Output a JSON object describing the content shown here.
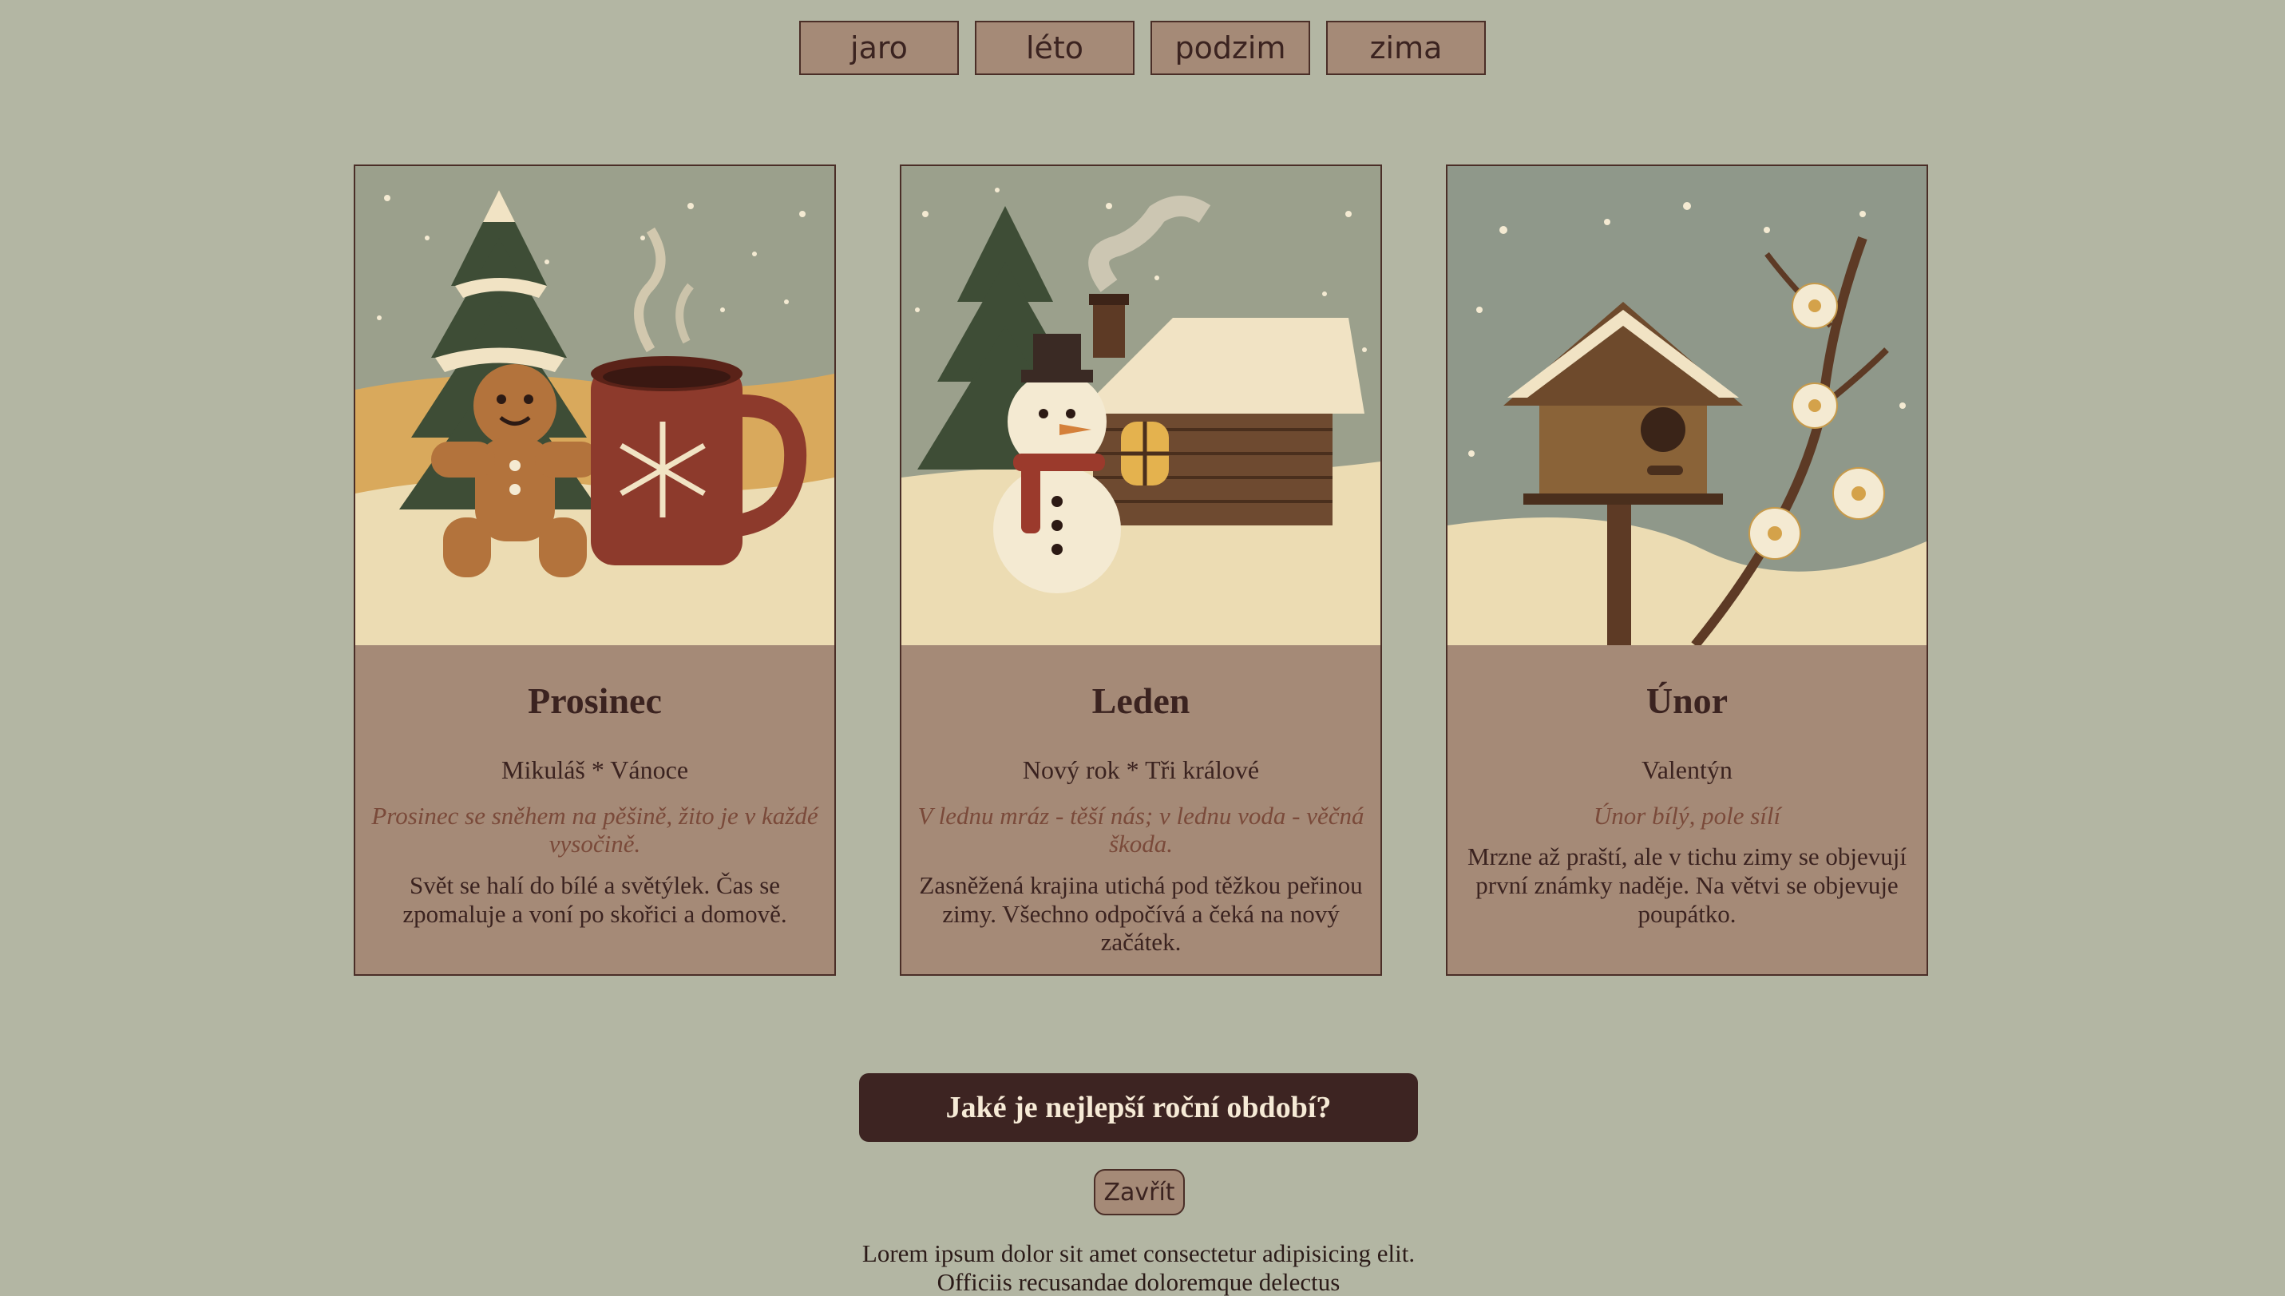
{
  "nav": {
    "items": [
      "jaro",
      "léto",
      "podzim",
      "zima"
    ]
  },
  "cards": [
    {
      "title": "Prosinec",
      "events": "Mikuláš * Vánoce",
      "proverb": "Prosinec se sněhem na pěšině, žito je v každé vysočině.",
      "text": "Svět se halí do bílé a světýlek. Čas se zpomaluje a voní po skořici a domově."
    },
    {
      "title": "Leden",
      "events": "Nový rok * Tři králové",
      "proverb": "V lednu mráz - těší nás; v lednu voda - věčná škoda.",
      "text": "Zasněžená krajina utichá pod těžkou peřinou zimy. Všechno odpočívá a čeká na nový začátek."
    },
    {
      "title": "Únor",
      "events": "Valentýn",
      "proverb": "Únor bílý, pole sílí",
      "text": "Mrzne až praští, ale v tichu zimy se objevují první známky naděje. Na větvi se objevuje poupátko."
    }
  ],
  "question": "Jaké je nejlepší roční období?",
  "close_label": "Zavřít",
  "lorem": "Lorem ipsum dolor sit amet consectetur adipisicing elit. Officiis recusandae doloremque delectus",
  "colors": {
    "background": "#b3b6a3",
    "card": "#a58a77",
    "border": "#4a2e27",
    "dark": "#3d2422",
    "proverb": "#7a4a3a"
  }
}
